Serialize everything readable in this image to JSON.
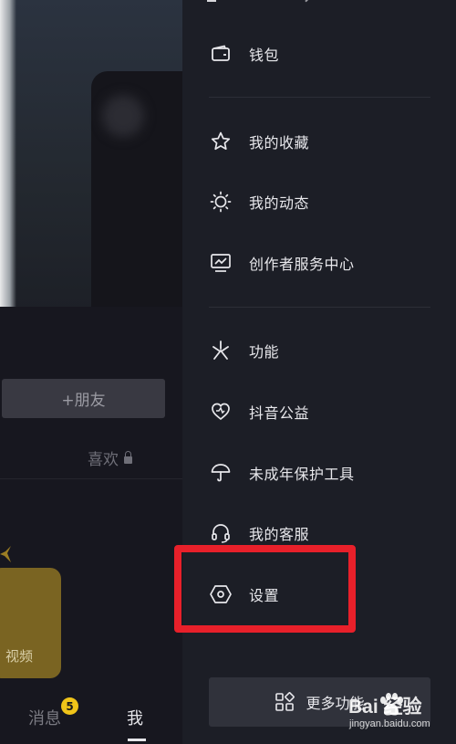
{
  "left_page": {
    "add_friend_label": "+朋友",
    "likes_tab_label": "喜欢",
    "video_card_label": "视频",
    "bottom_tabs": [
      {
        "label": "消息",
        "badge": "5"
      },
      {
        "label": "我"
      }
    ]
  },
  "drawer": {
    "items": [
      {
        "id": "wallet",
        "label": "钱包",
        "icon": "wallet-icon"
      },
      {
        "id": "favorites",
        "label": "我的收藏",
        "icon": "star-icon"
      },
      {
        "id": "activity",
        "label": "我的动态",
        "icon": "sun-icon"
      },
      {
        "id": "creator",
        "label": "创作者服务中心",
        "icon": "monitor-chart-icon"
      },
      {
        "id": "features",
        "label": "功能",
        "icon": "sparkle-icon"
      },
      {
        "id": "charity",
        "label": "抖音公益",
        "icon": "heart-hands-icon"
      },
      {
        "id": "minor",
        "label": "未成年保护工具",
        "icon": "umbrella-icon"
      },
      {
        "id": "support",
        "label": "我的客服",
        "icon": "headset-icon"
      },
      {
        "id": "settings",
        "label": "设置",
        "icon": "hexagon-settings-icon"
      }
    ],
    "more_button_label": "更多功能"
  },
  "watermark": {
    "title": "Bai 经验",
    "subtitle": "jingyan.baidu.com"
  },
  "colors": {
    "highlight": "#e8202a",
    "badge": "#f0c419",
    "drawer_bg": "#1c1e26"
  }
}
